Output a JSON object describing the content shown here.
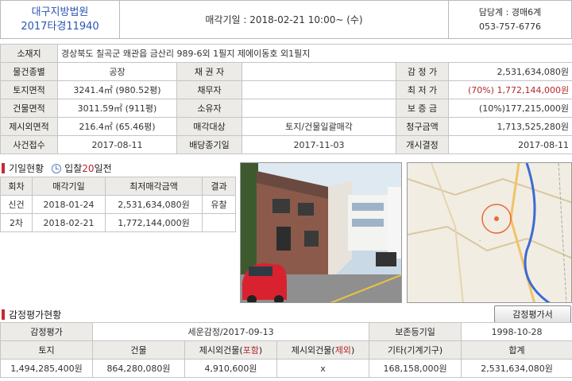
{
  "header": {
    "court": "대구지방법원",
    "case_no": "2017타경11940",
    "sale_date": "매각기일 : 2018-02-21   10:00~ (수)",
    "dept": "담당계 : 경매6계",
    "phone": "053-757-6776"
  },
  "info": {
    "location_label": "소재지",
    "location_value": "경상북도 칠곡군 왜관읍 금산리 989-6외 1필지 제에이동호 외1필지",
    "rows": [
      [
        "물건종별",
        "공장",
        "채 권 자",
        "",
        "감 정 가",
        "2,531,634,080원"
      ],
      [
        "토지면적",
        "3241.4㎡ (980.52평)",
        "채무자",
        "",
        "최 저 가",
        "(70%) 1,772,144,000원"
      ],
      [
        "건물면적",
        "3011.59㎡ (911평)",
        "소유자",
        "",
        "보 증 금",
        "(10%)177,215,000원"
      ],
      [
        "제시외면적",
        "216.4㎡ (65.46평)",
        "매각대상",
        "토지/건물일괄매각",
        "청구금액",
        "1,713,525,280원"
      ],
      [
        "사건접수",
        "2017-08-11",
        "배당종기일",
        "2017-11-03",
        "개시결정",
        "2017-08-11"
      ]
    ]
  },
  "history": {
    "title": "기일현황",
    "bid_label": "입찰",
    "bid_days": "20",
    "bid_suffix": "일전",
    "headers": [
      "회차",
      "매각기일",
      "최저매각금액",
      "결과"
    ],
    "rows": [
      [
        "신건",
        "2018-01-24",
        "2,531,634,080원",
        "유찰"
      ],
      [
        "2차",
        "2018-02-21",
        "1,772,144,000원",
        ""
      ]
    ]
  },
  "appraisal": {
    "title": "감정평가현황",
    "button": "감정평가서",
    "row1": [
      "감정평가",
      "세운감정/2017-09-13",
      "보존등기일",
      "1998-10-28"
    ],
    "headers": [
      "토지",
      "건물",
      "제시외건물(포함)",
      "제시외건물(제외)",
      "기타(기계기구)",
      "합계"
    ],
    "values": [
      "1,494,285,400원",
      "864,280,080원",
      "4,910,600원",
      "x",
      "168,158,000원",
      "2,531,634,080원"
    ]
  },
  "colors": {
    "accent_blue": "#2b55b0",
    "accent_red": "#c8292e",
    "header_bg": "#ecebe8"
  }
}
